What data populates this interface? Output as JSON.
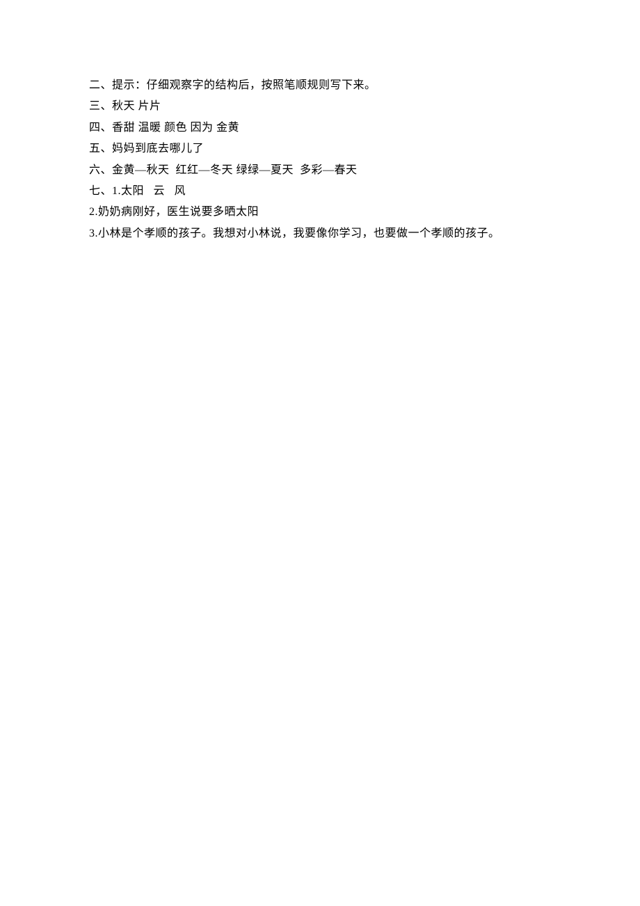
{
  "lines": [
    "二、提示：仔细观察字的结构后，按照笔顺规则写下来。",
    "三、秋天 片片",
    "四、香甜 温暖 颜色 因为 金黄",
    "五、妈妈到底去哪儿了",
    "六、金黄—秋天  红红—冬天 绿绿—夏天  多彩—春天",
    "七、1.太阳   云   风",
    "2.奶奶病刚好，医生说要多晒太阳",
    "3.小林是个孝顺的孩子。我想对小林说，我要像你学习，也要做一个孝顺的孩子。"
  ]
}
